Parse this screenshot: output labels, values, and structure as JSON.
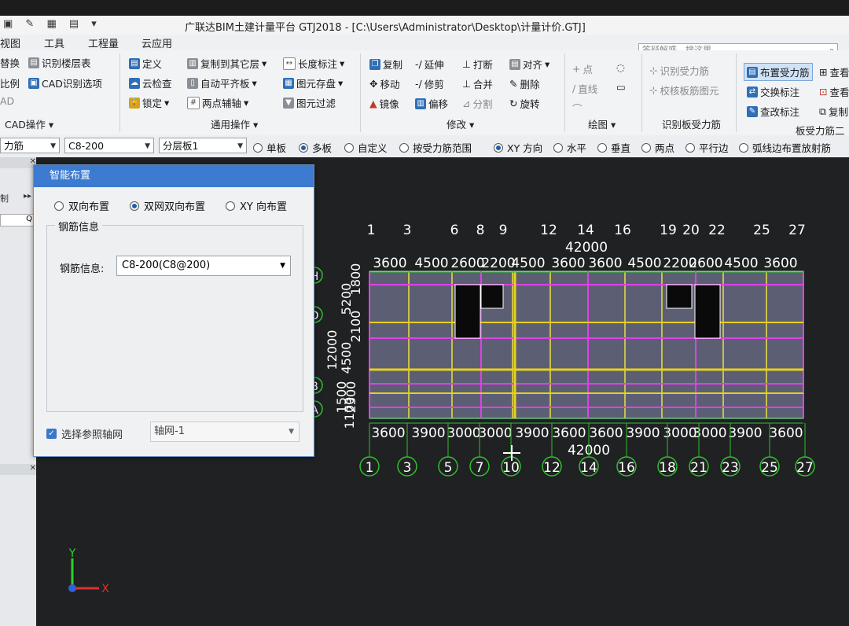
{
  "window": {
    "title": "广联达BIM土建计量平台 GTJ2018 - [C:\\Users\\Administrator\\Desktop\\计量计价.GTJ]"
  },
  "menu": [
    "视图",
    "工具",
    "工程量",
    "云应用"
  ],
  "search": {
    "placeholder": "答疑解惑，搜这里"
  },
  "ribbon": {
    "cad": {
      "items": [
        "替换",
        "识别楼层表",
        "比例",
        "CAD识别选项",
        "AD"
      ],
      "label": "CAD操作"
    },
    "general": {
      "items": [
        "定义",
        "复制到其它层",
        "长度标注",
        "云检查",
        "自动平齐板",
        "图元存盘",
        "锁定",
        "两点辅轴",
        "图元过滤"
      ],
      "label": "通用操作"
    },
    "modify": {
      "items": [
        "复制",
        "延伸",
        "打断",
        "对齐",
        "移动",
        "修剪",
        "合并",
        "删除",
        "镜像",
        "偏移",
        "分割",
        "旋转"
      ],
      "label": "修改"
    },
    "draw": {
      "items": [
        "点",
        "直线"
      ],
      "label": "绘图"
    },
    "identify": {
      "items": [
        "识别受力筋",
        "校核板筋图元"
      ],
      "label": "识别板受力筋"
    },
    "rebar2d": {
      "items": [
        "布置受力筋",
        "交换标注",
        "查改标注",
        "查看",
        "查看",
        "复制"
      ],
      "label": "板受力筋二次"
    }
  },
  "options": {
    "dropdowns": [
      "力筋",
      "C8-200",
      "分层板1"
    ],
    "radios": [
      {
        "label": "单板",
        "checked": false
      },
      {
        "label": "多板",
        "checked": true
      },
      {
        "label": "自定义",
        "checked": false
      },
      {
        "label": "按受力筋范围",
        "checked": false
      },
      {
        "label": "XY 方向",
        "checked": true
      },
      {
        "label": "水平",
        "checked": false
      },
      {
        "label": "垂直",
        "checked": false
      },
      {
        "label": "两点",
        "checked": false
      },
      {
        "label": "平行边",
        "checked": false
      },
      {
        "label": "弧线边布置放射筋",
        "checked": false
      }
    ]
  },
  "left_panel": {
    "label1": "制",
    "search": "Q"
  },
  "dialog": {
    "title": "智能布置",
    "modes": [
      {
        "label": "双向布置",
        "checked": false
      },
      {
        "label": "双网双向布置",
        "checked": true
      },
      {
        "label": "XY 向布置",
        "checked": false
      }
    ],
    "group_title": "钢筋信息",
    "field_label": "钢筋信息:",
    "field_value": "C8-200(C8@200)",
    "ref_axis_label": "选择参照轴网",
    "ref_axis_value": "轴网-1"
  },
  "drawing": {
    "top_axes": [
      "1",
      "3",
      "6",
      "8",
      "9",
      "12",
      "14",
      "16",
      "19",
      "20",
      "22",
      "25",
      "27"
    ],
    "top_total": "42000",
    "top_dims": [
      "3600",
      "4500",
      "2600",
      "2200",
      "4500",
      "3600",
      "3600",
      "4500",
      "2200",
      "2600",
      "4500",
      "3600"
    ],
    "bottom_dims": [
      "3600",
      "3900",
      "3000",
      "3000",
      "3900",
      "3600",
      "3600",
      "3900",
      "3000",
      "3000",
      "3900",
      "3600"
    ],
    "bottom_total": "42000",
    "bottom_axes": [
      "1",
      "3",
      "5",
      "7",
      "10",
      "12",
      "14",
      "16",
      "18",
      "21",
      "23",
      "25",
      "27"
    ],
    "left_dims": [
      "12000",
      "4500",
      "2100",
      "5200",
      "1800",
      "1500",
      "2300",
      "1100"
    ],
    "row_axes": [
      "H",
      "D",
      "B",
      "A"
    ],
    "coord": {
      "y": "Y",
      "x": "X"
    }
  },
  "colors": {
    "accent": "#3c7bd0",
    "slab": "#5c5f74",
    "rebar_magenta": "#e040e8",
    "rebar_yellow": "#e8d020",
    "dim_green": "#2fbf2f"
  }
}
